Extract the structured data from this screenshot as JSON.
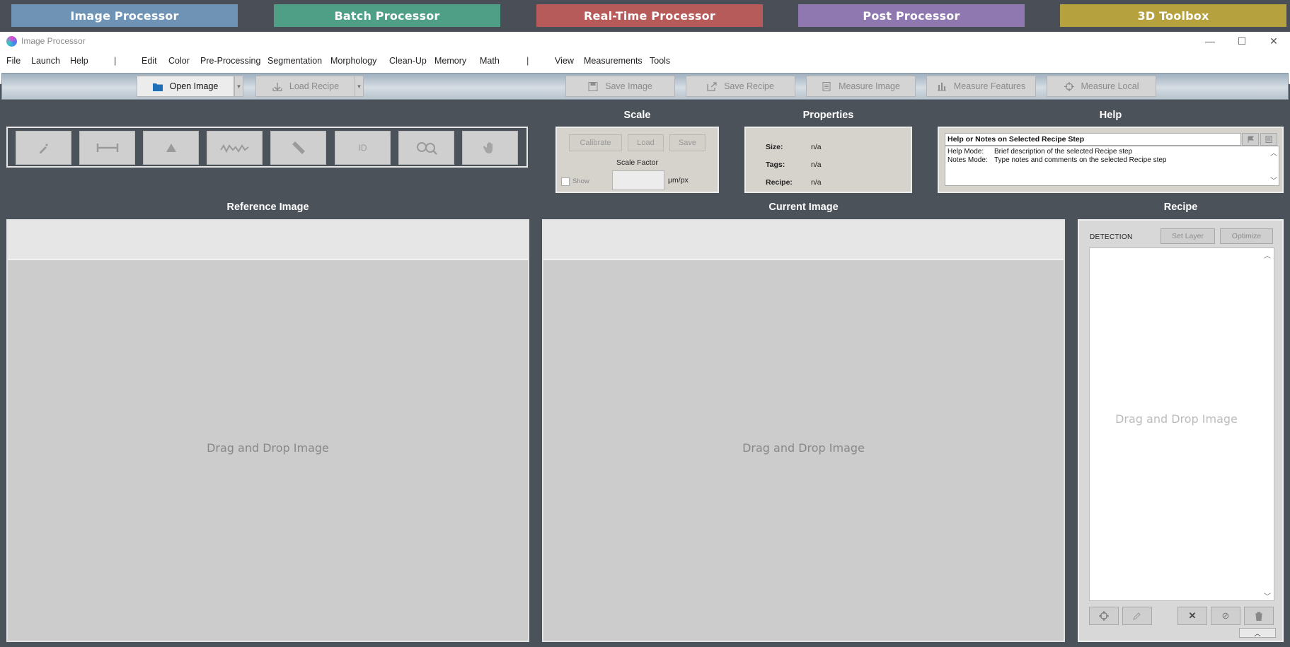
{
  "launcher": {
    "image_processor": "Image Processor",
    "batch_processor": "Batch Processor",
    "realtime_processor": "Real-Time Processor",
    "post_processor": "Post Processor",
    "toolbox_3d": "3D Toolbox",
    "colors": {
      "image": "#6f93b5",
      "batch": "#4f9e86",
      "realtime": "#b65a5a",
      "post": "#8f78b0",
      "toolbox": "#b5a23e"
    }
  },
  "window": {
    "title": "Image Processor",
    "minimize_icon": "—",
    "maximize_icon": "☐",
    "close_icon": "✕"
  },
  "menu": {
    "file": "File",
    "launch": "Launch",
    "help": "Help",
    "sep1": "|",
    "edit": "Edit",
    "color": "Color",
    "preprocessing": "Pre-Processing",
    "segmentation": "Segmentation",
    "morphology": "Morphology",
    "cleanup": "Clean-Up",
    "memory": "Memory",
    "math": "Math",
    "sep2": "|",
    "view": "View",
    "measurements": "Measurements",
    "tools": "Tools"
  },
  "toolbar": {
    "open_image": "Open Image",
    "load_recipe": "Load Recipe",
    "save_image": "Save Image",
    "save_recipe": "Save Recipe",
    "measure_image": "Measure Image",
    "measure_features": "Measure Features",
    "measure_local": "Measure Local"
  },
  "tools": {
    "id_label": "ID"
  },
  "scale": {
    "title": "Scale",
    "calibrate": "Calibrate",
    "load": "Load",
    "save": "Save",
    "factor_label": "Scale Factor",
    "unit": "μm/px",
    "show_label": "Show"
  },
  "properties": {
    "title": "Properties",
    "size_label": "Size:",
    "size_value": "n/a",
    "tags_label": "Tags:",
    "tags_value": "n/a",
    "recipe_label": "Recipe:",
    "recipe_value": "n/a"
  },
  "help": {
    "title": "Help",
    "header": "Help or Notes on Selected Recipe Step",
    "help_mode_key": "Help Mode:",
    "help_mode_text": "Brief description of the selected Recipe step",
    "notes_mode_key": "Notes Mode:",
    "notes_mode_text": "Type notes and comments on the selected Recipe step"
  },
  "reference": {
    "title": "Reference Image",
    "drop": "Drag and Drop Image"
  },
  "current": {
    "title": "Current Image",
    "drop": "Drag and Drop Image"
  },
  "recipe": {
    "title": "Recipe",
    "section": "DETECTION",
    "set_layer": "Set Layer",
    "optimize": "Optimize",
    "drop": "Drag and Drop Image"
  }
}
